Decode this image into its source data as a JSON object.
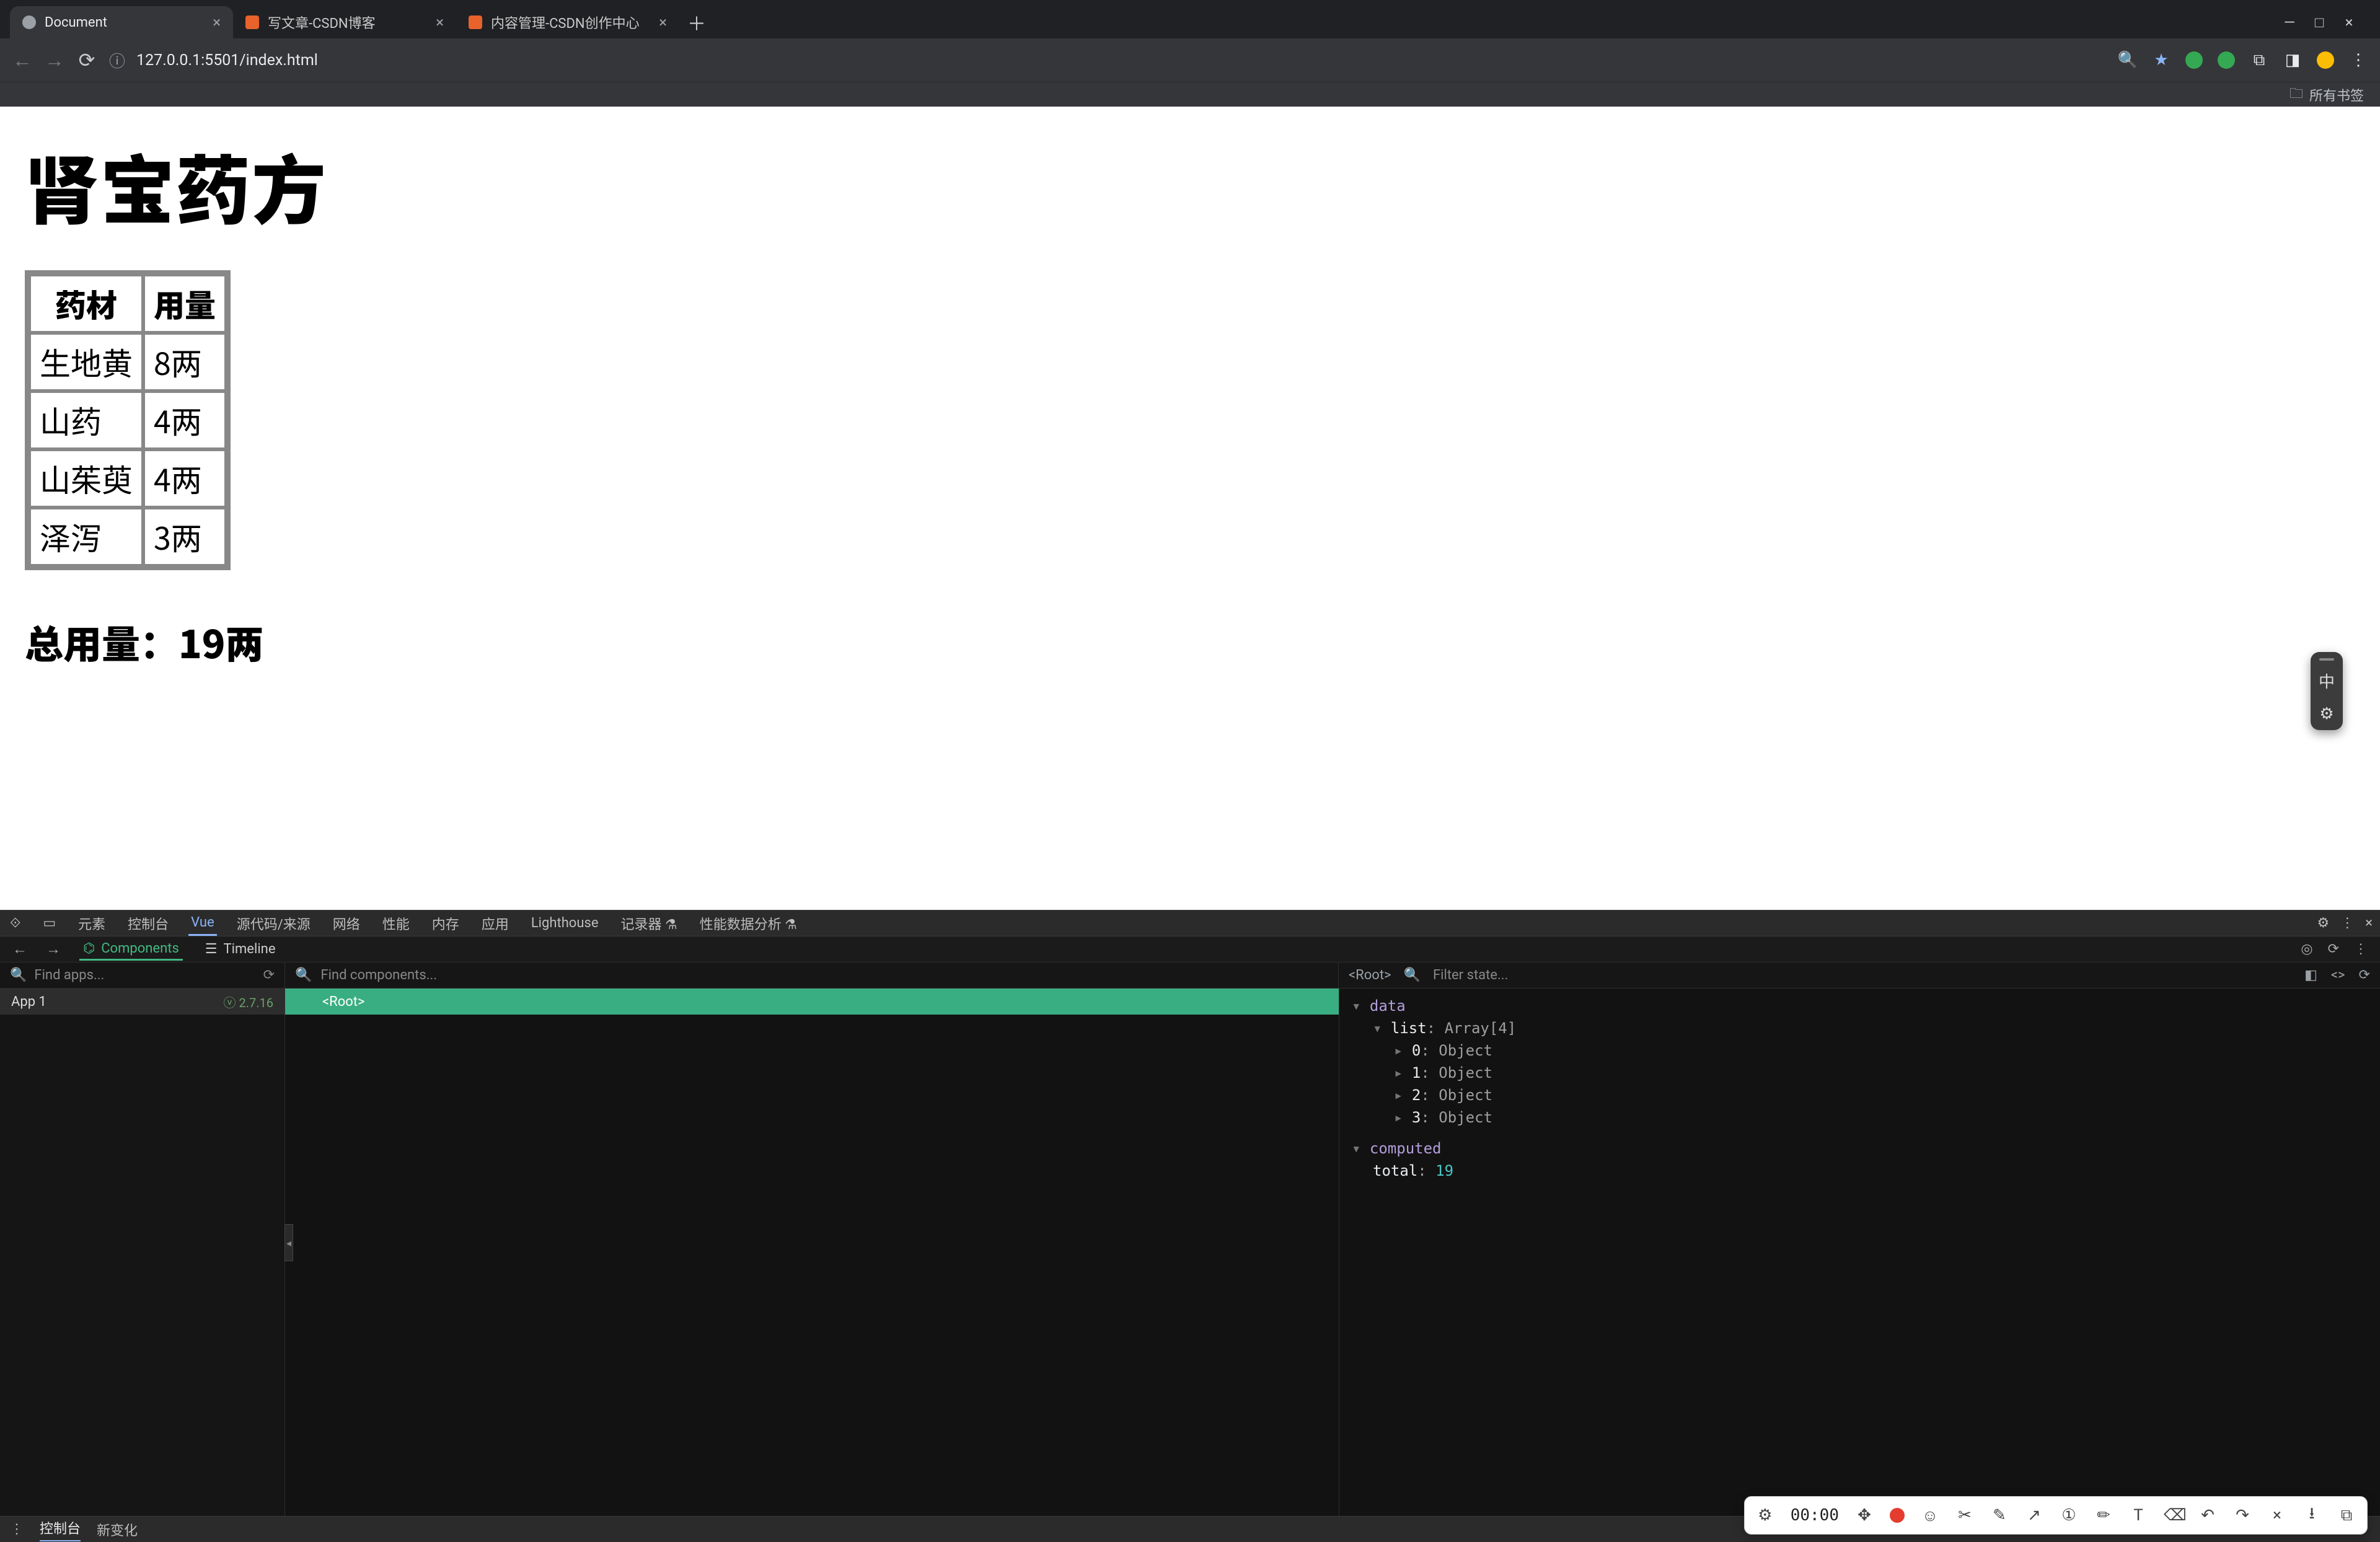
{
  "browser": {
    "tabs": [
      {
        "title": "Document",
        "active": true
      },
      {
        "title": "写文章-CSDN博客",
        "active": false
      },
      {
        "title": "内容管理-CSDN创作中心",
        "active": false
      }
    ],
    "url": "127.0.0.1:5501/index.html",
    "bookmarks_label": "所有书签"
  },
  "page": {
    "heading": "肾宝药方",
    "table": {
      "headers": [
        "药材",
        "用量"
      ],
      "rows": [
        [
          "生地黄",
          "8两"
        ],
        [
          "山药",
          "4两"
        ],
        [
          "山茱萸",
          "4两"
        ],
        [
          "泽泻",
          "3两"
        ]
      ]
    },
    "total_label": "总用量：19两",
    "ime_char": "中"
  },
  "devtools": {
    "main_tabs": [
      "元素",
      "控制台",
      "Vue",
      "源代码/来源",
      "网络",
      "性能",
      "内存",
      "应用",
      "Lighthouse",
      "记录器 ⚗",
      "性能数据分析 ⚗"
    ],
    "main_active": "Vue",
    "sub_tabs": {
      "components": "Components",
      "timeline": "Timeline"
    },
    "find_apps": "Find apps...",
    "find_components": "Find components...",
    "root_label": "<Root>",
    "filter_state": "Filter state...",
    "app_name": "App 1",
    "vue_version": "2.7.16",
    "state": {
      "data_label": "data",
      "list_label": "list",
      "list_type": "Array[4]",
      "items": [
        "0: Object",
        "1: Object",
        "2: Object",
        "3: Object"
      ],
      "computed_label": "computed",
      "total_key": "total",
      "total_val": "19"
    },
    "drawer_tabs": [
      "控制台",
      "新变化"
    ]
  },
  "recorder": {
    "time": "00:00"
  },
  "chart_data": {
    "type": "table",
    "title": "肾宝药方",
    "columns": [
      "药材",
      "用量(两)"
    ],
    "rows": [
      {
        "药材": "生地黄",
        "用量(两)": 8
      },
      {
        "药材": "山药",
        "用量(两)": 4
      },
      {
        "药材": "山茱萸",
        "用量(两)": 4
      },
      {
        "药材": "泽泻",
        "用量(两)": 3
      }
    ],
    "total": 19
  }
}
